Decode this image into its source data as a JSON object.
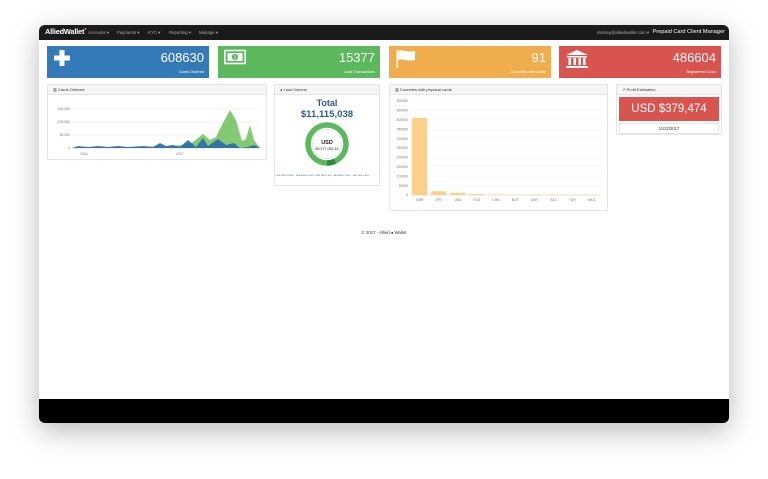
{
  "nav": {
    "brand": "AlliedWallet",
    "menu": [
      "Accounts ▾",
      "Payments ▾",
      "KYC ▾",
      "Reporting ▾",
      "Manage ▾"
    ],
    "user": "ramsey@alliedwallet.com ▾",
    "app_title": "Prepaid Card Client Manager"
  },
  "stats": [
    {
      "value": "608630",
      "label": "Cards Ordered",
      "icon": "plus-icon",
      "color": "#337ab7"
    },
    {
      "value": "15377",
      "label": "Load Transactions",
      "icon": "money-icon",
      "color": "#5cb85c"
    },
    {
      "value": "91",
      "label": "Countries with Cards",
      "icon": "flag-icon",
      "color": "#f0ad4e"
    },
    {
      "value": "486604",
      "label": "Registered Cards",
      "icon": "bank-icon",
      "color": "#d9534f"
    }
  ],
  "cards_panel": {
    "title": "Cards Ordered",
    "y_ticks": [
      "150,000",
      "100,000",
      "50,000",
      "0"
    ],
    "x_ticks": [
      "2016",
      "2017"
    ]
  },
  "load_panel": {
    "title": "Load Volume",
    "total_label": "Total",
    "total_value": "$11,115,038",
    "donut_currency": "USD",
    "donut_amount": "$9,377,052.44",
    "legend": "USD USD 81.88% · EUR EUR 10.00% · GBP GBP 5.00% · AUD AUD 1.00% · GBP GBP 0.40%"
  },
  "countries_panel": {
    "title": "Countries with physical cards"
  },
  "profit_panel": {
    "title": "Profit Estimation",
    "value": "USD $379,474",
    "date": "11/22/2017"
  },
  "footer": {
    "text": "© 2017 - Allied ● Wallet"
  },
  "chart_data": {
    "type": "bar",
    "categories": [
      "GBR",
      "JPN",
      "USA",
      "RUS",
      "CHN",
      "BLR",
      "UKR",
      "KAZ",
      "TUR",
      "MKD"
    ],
    "values": [
      410000,
      20000,
      12000,
      5000,
      3000,
      2500,
      2000,
      1500,
      1500,
      1000
    ],
    "y_ticks": [
      0,
      50000,
      100000,
      150000,
      200000,
      250000,
      300000,
      350000,
      400000,
      450000,
      500000
    ],
    "ylim": [
      0,
      500000
    ],
    "bar_color": "#fcd08a"
  }
}
